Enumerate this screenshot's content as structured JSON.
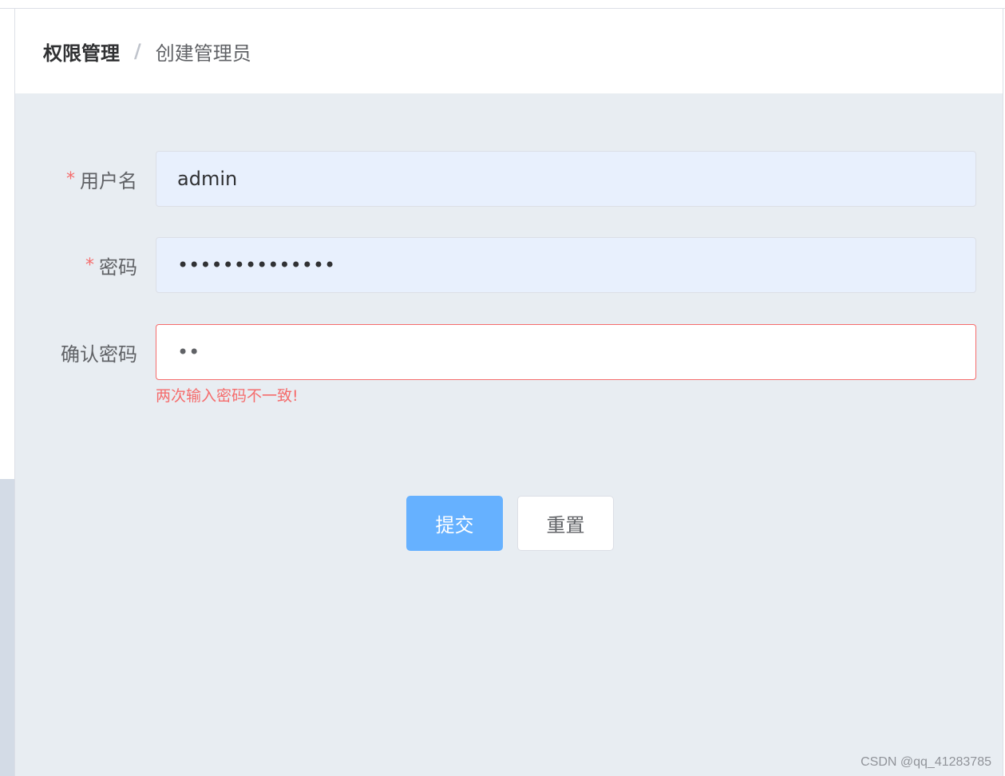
{
  "breadcrumb": {
    "parent": "权限管理",
    "separator": "/",
    "current": "创建管理员"
  },
  "form": {
    "username": {
      "label": "用户名",
      "required_mark": "*",
      "value": "admin"
    },
    "password": {
      "label": "密码",
      "required_mark": "*",
      "value": "••••••••••••••"
    },
    "confirm_password": {
      "label": "确认密码",
      "value": "••",
      "error": "两次输入密码不一致!"
    }
  },
  "buttons": {
    "submit": "提交",
    "reset": "重置"
  },
  "watermark": "CSDN @qq_41283785",
  "colors": {
    "primary": "#66b1ff",
    "error": "#f56c6c",
    "background": "#e8edf2",
    "autofill": "#e8f0fd"
  }
}
